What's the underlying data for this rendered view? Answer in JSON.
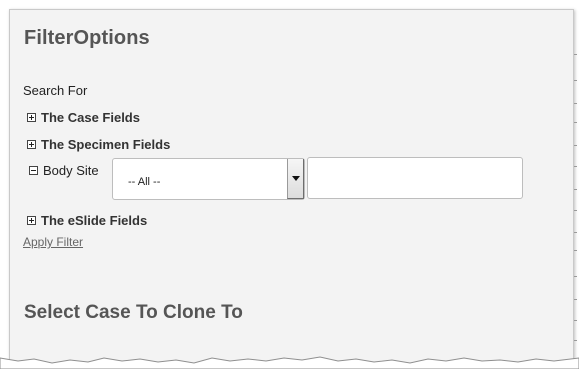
{
  "filter_panel": {
    "title": "FilterOptions",
    "search_for_label": "Search For",
    "groups": {
      "case_fields": {
        "label": "The Case Fields",
        "state": "collapsed"
      },
      "specimen_fields": {
        "label": "The Specimen Fields",
        "state": "collapsed"
      },
      "eslide_fields": {
        "label": "The eSlide Fields",
        "state": "collapsed"
      }
    },
    "body_site": {
      "label": "Body Site",
      "state": "expanded",
      "select_value": "-- All --",
      "text_value": "",
      "text_placeholder": ""
    },
    "apply_filter_label": "Apply Filter"
  },
  "clone_section": {
    "title": "Select Case To Clone To"
  },
  "icons": {
    "expand": "plus-box-icon",
    "collapse": "minus-box-icon",
    "dropdown": "chevron-down-icon"
  },
  "colors": {
    "panel_background": "#f3f3f3",
    "heading": "#555555",
    "link": "#666666"
  }
}
